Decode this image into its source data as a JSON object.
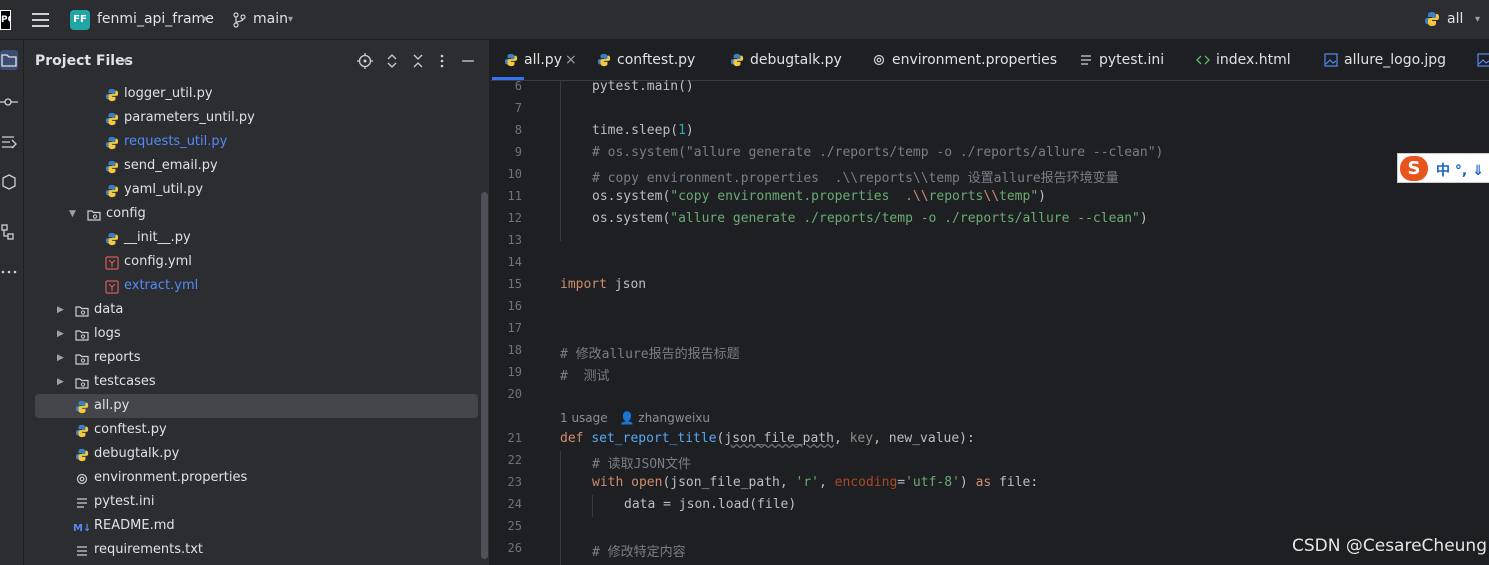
{
  "titlebar": {
    "logo_text": "PC",
    "project_badge": "FF",
    "project_name": "fenmi_api_frame",
    "branch": "main",
    "run_config": "all"
  },
  "project_panel": {
    "title": "Project Files",
    "tree": [
      {
        "label": "logger_util.py",
        "type": "py",
        "modified": false
      },
      {
        "label": "parameters_until.py",
        "type": "py",
        "modified": false
      },
      {
        "label": "requests_util.py",
        "type": "py",
        "modified": true
      },
      {
        "label": "send_email.py",
        "type": "py",
        "modified": false
      },
      {
        "label": "yaml_util.py",
        "type": "py",
        "modified": false
      },
      {
        "label": "config",
        "type": "folder-open",
        "modified": false
      },
      {
        "label": "__init__.py",
        "type": "py",
        "modified": false
      },
      {
        "label": "config.yml",
        "type": "yml",
        "modified": false
      },
      {
        "label": "extract.yml",
        "type": "yml",
        "modified": true
      },
      {
        "label": "data",
        "type": "folder",
        "modified": false
      },
      {
        "label": "logs",
        "type": "folder",
        "modified": false
      },
      {
        "label": "reports",
        "type": "folder",
        "modified": false
      },
      {
        "label": "testcases",
        "type": "folder",
        "modified": false
      },
      {
        "label": "all.py",
        "type": "py",
        "modified": false,
        "selected": true
      },
      {
        "label": "conftest.py",
        "type": "py",
        "modified": false
      },
      {
        "label": "debugtalk.py",
        "type": "py",
        "modified": false
      },
      {
        "label": "environment.properties",
        "type": "props",
        "modified": false
      },
      {
        "label": "pytest.ini",
        "type": "ini",
        "modified": false
      },
      {
        "label": "README.md",
        "type": "md",
        "modified": false
      },
      {
        "label": "requirements.txt",
        "type": "txt",
        "modified": false
      }
    ]
  },
  "tabs": [
    {
      "label": "all.py",
      "icon": "python-icon",
      "active": true
    },
    {
      "label": "conftest.py",
      "icon": "python-icon"
    },
    {
      "label": "debugtalk.py",
      "icon": "python-icon"
    },
    {
      "label": "environment.properties",
      "icon": "gear-icon"
    },
    {
      "label": "pytest.ini",
      "icon": "ini-icon"
    },
    {
      "label": "index.html",
      "icon": "html-icon"
    },
    {
      "label": "allure_logo.jpg",
      "icon": "image-icon"
    }
  ],
  "tab_close": "×",
  "editor": {
    "line_numbers": [
      "6",
      "7",
      "8",
      "9",
      "10",
      "11",
      "12",
      "13",
      "14",
      "15",
      "16",
      "17",
      "18",
      "19",
      "20",
      "21",
      "22",
      "23",
      "24",
      "25",
      "26"
    ],
    "inlay_usage": "1 usage",
    "inlay_author": "zhangweixu",
    "lines": {
      "l6": "pytest.main()",
      "l8a": "time.sleep(",
      "l8b": "1",
      "l8c": ")",
      "l9": "# os.system(\"allure generate ./reports/temp -o ./reports/allure --clean\")",
      "l10": "# copy environment.properties  .\\\\reports\\\\temp 设置allure报告环境变量",
      "l11a": "os.system(",
      "l11b": "\"copy environment.properties  .",
      "l11c": "\\\\",
      "l11d": "reports",
      "l11e": "\\\\",
      "l11f": "temp\"",
      "l11g": ")",
      "l12a": "os.system(",
      "l12b": "\"allure generate ./reports/temp -o ./reports/allure --clean\"",
      "l12c": ")",
      "l15a": "import",
      "l15b": " json",
      "l18": "# 修改allure报告的报告标题",
      "l19": "#  测试",
      "l21a": "def",
      "l21b": "set_report_title",
      "l21c": "(",
      "l21d": "json_file_path",
      "l21e": ", ",
      "l21f": "key",
      "l21g": ", new_value):",
      "l22": "# 读取JSON文件",
      "l23a": "with",
      "l23b": "open",
      "l23c": "(json_file_path, ",
      "l23d": "'r'",
      "l23e": ", ",
      "l23f": "encoding",
      "l23g": "=",
      "l23h": "'utf-8'",
      "l23i": ") ",
      "l23j": "as",
      "l23k": " file:",
      "l24": "data = json.load(file)",
      "l26": "# 修改特定内容"
    }
  },
  "ime": {
    "logo": "S",
    "text": "中 °, ⇓"
  },
  "watermark": "CSDN @CesareCheung"
}
